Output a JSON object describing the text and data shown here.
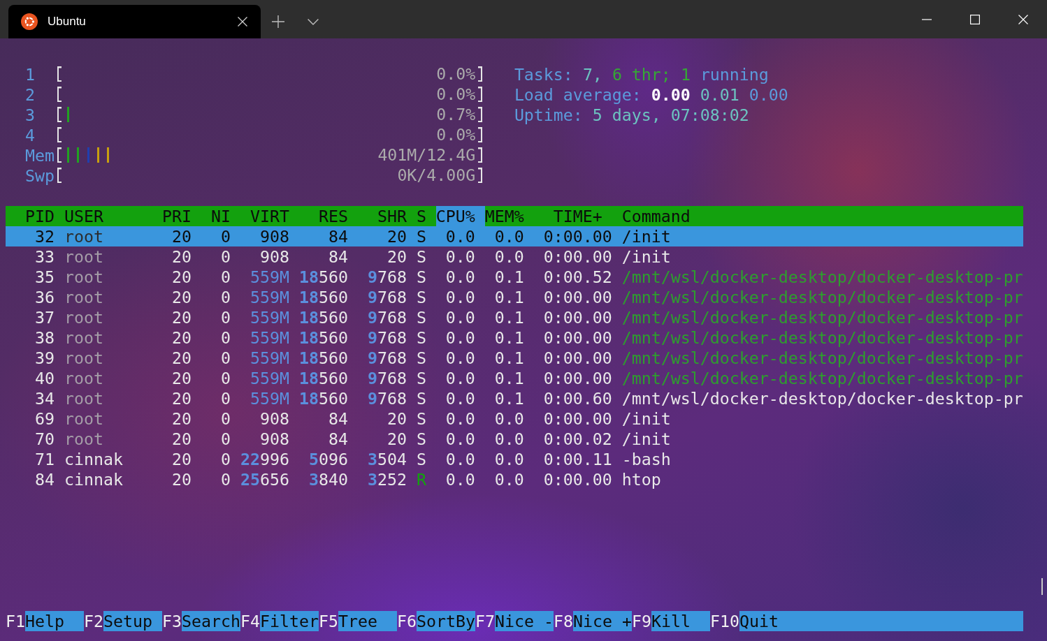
{
  "tabs": [
    {
      "title": "Ubuntu",
      "selected": true
    }
  ],
  "meters": [
    {
      "label": "1",
      "value": "0.0%"
    },
    {
      "label": "2",
      "value": "0.0%"
    },
    {
      "label": "3",
      "level": 0.024,
      "value": "0.7%"
    },
    {
      "label": "4",
      "value": "0.0%"
    },
    {
      "label": "Mem",
      "segments": [
        {
          "color": "#22a022",
          "level": 0.048
        },
        {
          "color": "#1f3fb0",
          "level": 0.024
        },
        {
          "color": "#c79f10",
          "level": 0.048
        }
      ],
      "value": "401M/12.4G"
    },
    {
      "label": "Swp",
      "value": "0K/4.00G"
    }
  ],
  "summary": [
    {
      "parts": [
        {
          "text": "Tasks:",
          "kind": "label"
        },
        {
          "text": "7,",
          "kind": "value"
        },
        {
          "text": "6 thr;",
          "kind": "thread"
        },
        {
          "text": "1",
          "kind": "thread"
        },
        {
          "text": "running",
          "kind": "label"
        }
      ]
    },
    {
      "parts": [
        {
          "text": "Load average:",
          "kind": "label"
        },
        {
          "text": "0.00",
          "kind": "bright"
        },
        {
          "text": "0.01",
          "kind": "value"
        },
        {
          "text": "0.00",
          "kind": "label"
        }
      ]
    },
    {
      "parts": [
        {
          "text": "Uptime:",
          "kind": "label"
        },
        {
          "text": "5 days, 07:08:02",
          "kind": "value"
        }
      ]
    }
  ],
  "table": {
    "columns": [
      {
        "label": "PID",
        "selected": false
      },
      {
        "label": "USER",
        "selected": false
      },
      {
        "label": "PRI",
        "selected": false
      },
      {
        "label": "NI",
        "selected": false
      },
      {
        "label": "VIRT",
        "selected": false
      },
      {
        "label": "RES",
        "selected": false
      },
      {
        "label": "SHR",
        "selected": false
      },
      {
        "label": "S",
        "selected": false
      },
      {
        "label": "CPU%",
        "selected": true
      },
      {
        "label": "MEM%",
        "selected": false
      },
      {
        "label": "TIME+",
        "selected": false
      },
      {
        "label": "Command",
        "selected": false
      }
    ],
    "rows": [
      {
        "selected": true,
        "shadowed": true,
        "thread": false,
        "running": false,
        "virt_large": false,
        "pid": "32",
        "user": "root",
        "pri": "20",
        "ni": "0",
        "virt": "908",
        "res": "84",
        "shr": "20",
        "state": "S",
        "cpu": "0.0",
        "mem": "0.0",
        "time": "0:00.00",
        "command": "/init"
      },
      {
        "selected": false,
        "shadowed": true,
        "thread": false,
        "running": false,
        "virt_large": false,
        "pid": "33",
        "user": "root",
        "pri": "20",
        "ni": "0",
        "virt": "908",
        "res": "84",
        "shr": "20",
        "state": "S",
        "cpu": "0.0",
        "mem": "0.0",
        "time": "0:00.00",
        "command": "/init"
      },
      {
        "selected": false,
        "shadowed": true,
        "thread": true,
        "running": false,
        "virt_large": true,
        "pid": "35",
        "user": "root",
        "pri": "20",
        "ni": "0",
        "virt": "559M",
        "res": "**18**560",
        "shr": "**9**768",
        "state": "S",
        "cpu": "0.0",
        "mem": "0.1",
        "time": "0:00.52",
        "command": "/mnt/wsl/docker-desktop/docker-desktop-pr"
      },
      {
        "selected": false,
        "shadowed": true,
        "thread": true,
        "running": false,
        "virt_large": true,
        "pid": "36",
        "user": "root",
        "pri": "20",
        "ni": "0",
        "virt": "559M",
        "res": "**18**560",
        "shr": "**9**768",
        "state": "S",
        "cpu": "0.0",
        "mem": "0.1",
        "time": "0:00.00",
        "command": "/mnt/wsl/docker-desktop/docker-desktop-pr"
      },
      {
        "selected": false,
        "shadowed": true,
        "thread": true,
        "running": false,
        "virt_large": true,
        "pid": "37",
        "user": "root",
        "pri": "20",
        "ni": "0",
        "virt": "559M",
        "res": "**18**560",
        "shr": "**9**768",
        "state": "S",
        "cpu": "0.0",
        "mem": "0.1",
        "time": "0:00.00",
        "command": "/mnt/wsl/docker-desktop/docker-desktop-pr"
      },
      {
        "selected": false,
        "shadowed": true,
        "thread": true,
        "running": false,
        "virt_large": true,
        "pid": "38",
        "user": "root",
        "pri": "20",
        "ni": "0",
        "virt": "559M",
        "res": "**18**560",
        "shr": "**9**768",
        "state": "S",
        "cpu": "0.0",
        "mem": "0.1",
        "time": "0:00.00",
        "command": "/mnt/wsl/docker-desktop/docker-desktop-pr"
      },
      {
        "selected": false,
        "shadowed": true,
        "thread": true,
        "running": false,
        "virt_large": true,
        "pid": "39",
        "user": "root",
        "pri": "20",
        "ni": "0",
        "virt": "559M",
        "res": "**18**560",
        "shr": "**9**768",
        "state": "S",
        "cpu": "0.0",
        "mem": "0.1",
        "time": "0:00.00",
        "command": "/mnt/wsl/docker-desktop/docker-desktop-pr"
      },
      {
        "selected": false,
        "shadowed": true,
        "thread": true,
        "running": false,
        "virt_large": true,
        "pid": "40",
        "user": "root",
        "pri": "20",
        "ni": "0",
        "virt": "559M",
        "res": "**18**560",
        "shr": "**9**768",
        "state": "S",
        "cpu": "0.0",
        "mem": "0.1",
        "time": "0:00.00",
        "command": "/mnt/wsl/docker-desktop/docker-desktop-pr"
      },
      {
        "selected": false,
        "shadowed": true,
        "thread": false,
        "running": false,
        "virt_large": true,
        "pid": "34",
        "user": "root",
        "pri": "20",
        "ni": "0",
        "virt": "559M",
        "res": "**18**560",
        "shr": "**9**768",
        "state": "S",
        "cpu": "0.0",
        "mem": "0.1",
        "time": "0:00.60",
        "command": "/mnt/wsl/docker-desktop/docker-desktop-pr"
      },
      {
        "selected": false,
        "shadowed": true,
        "thread": false,
        "running": false,
        "virt_large": false,
        "pid": "69",
        "user": "root",
        "pri": "20",
        "ni": "0",
        "virt": "908",
        "res": "84",
        "shr": "20",
        "state": "S",
        "cpu": "0.0",
        "mem": "0.0",
        "time": "0:00.00",
        "command": "/init"
      },
      {
        "selected": false,
        "shadowed": true,
        "thread": false,
        "running": false,
        "virt_large": false,
        "pid": "70",
        "user": "root",
        "pri": "20",
        "ni": "0",
        "virt": "908",
        "res": "84",
        "shr": "20",
        "state": "S",
        "cpu": "0.0",
        "mem": "0.0",
        "time": "0:00.02",
        "command": "/init"
      },
      {
        "selected": false,
        "shadowed": false,
        "thread": false,
        "running": false,
        "virt_large": false,
        "pid": "71",
        "user": "cinnak",
        "pri": "20",
        "ni": "0",
        "virt": "**22**996",
        "res": "**5**096",
        "shr": "**3**504",
        "state": "S",
        "cpu": "0.0",
        "mem": "0.0",
        "time": "0:00.11",
        "command": "-bash"
      },
      {
        "selected": false,
        "shadowed": false,
        "thread": false,
        "running": true,
        "virt_large": false,
        "pid": "84",
        "user": "cinnak",
        "pri": "20",
        "ni": "0",
        "virt": "**25**656",
        "res": "**3**840",
        "shr": "**3**252",
        "state": "R",
        "cpu": "0.0",
        "mem": "0.0",
        "time": "0:00.00",
        "command": "htop"
      }
    ]
  },
  "function_keys": [
    {
      "key": "F1",
      "label": "Help"
    },
    {
      "key": "F2",
      "label": "Setup"
    },
    {
      "key": "F3",
      "label": "Search"
    },
    {
      "key": "F4",
      "label": "Filter"
    },
    {
      "key": "F5",
      "label": "Tree"
    },
    {
      "key": "F6",
      "label": "SortBy"
    },
    {
      "key": "F7",
      "label": "Nice -"
    },
    {
      "key": "F8",
      "label": "Nice +"
    },
    {
      "key": "F9",
      "label": "Kill"
    },
    {
      "key": "F10",
      "label": "Quit"
    }
  ]
}
